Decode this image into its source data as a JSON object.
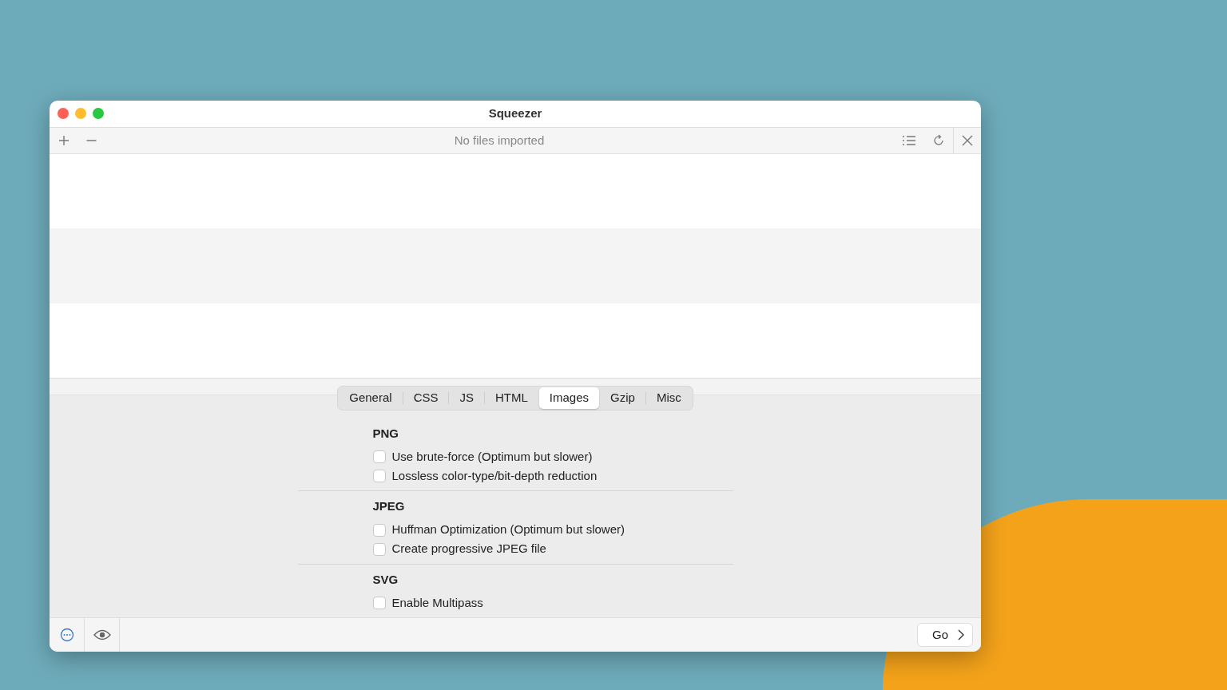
{
  "window": {
    "title": "Squeezer"
  },
  "toolbar": {
    "status": "No files imported"
  },
  "tabs": [
    {
      "label": "General",
      "selected": false
    },
    {
      "label": "CSS",
      "selected": false
    },
    {
      "label": "JS",
      "selected": false
    },
    {
      "label": "HTML",
      "selected": false
    },
    {
      "label": "Images",
      "selected": true
    },
    {
      "label": "Gzip",
      "selected": false
    },
    {
      "label": "Misc",
      "selected": false
    }
  ],
  "sections": [
    {
      "title": "PNG",
      "options": [
        {
          "label": "Use brute-force (Optimum but slower)",
          "checked": false
        },
        {
          "label": "Lossless color-type/bit-depth reduction",
          "checked": false
        }
      ]
    },
    {
      "title": "JPEG",
      "options": [
        {
          "label": "Huffman Optimization (Optimum but slower)",
          "checked": false
        },
        {
          "label": "Create progressive JPEG file",
          "checked": false
        }
      ]
    },
    {
      "title": "SVG",
      "options": [
        {
          "label": "Enable Multipass",
          "checked": false
        }
      ]
    }
  ],
  "footer": {
    "go_button": "Go"
  }
}
